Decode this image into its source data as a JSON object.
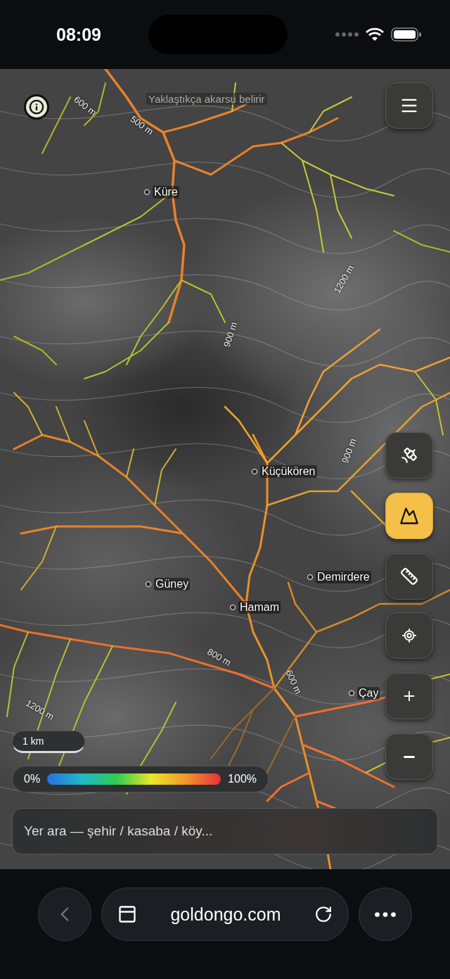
{
  "status_bar": {
    "time": "08:09"
  },
  "map": {
    "hint": "Yaklaştıkça akarsu belirir",
    "places": [
      "Küre",
      "Küçükören",
      "Güney",
      "Hamam",
      "Demirdere",
      "Çay"
    ],
    "contour_labels": [
      "600 m",
      "500 m",
      "1200 m",
      "900 m",
      "900 m",
      "800 m",
      "600 m",
      "1200 m"
    ]
  },
  "layer_buttons": [
    {
      "kind": "satellite",
      "selected": false
    },
    {
      "kind": "terrain",
      "selected": true
    },
    {
      "kind": "measure",
      "selected": false
    }
  ],
  "scale": "1 km",
  "legend": {
    "min": "0%",
    "max": "100%"
  },
  "search": {
    "placeholder": "Yer ara — şehir / kasaba / köy..."
  },
  "browser": {
    "url": "goldongo.com"
  }
}
